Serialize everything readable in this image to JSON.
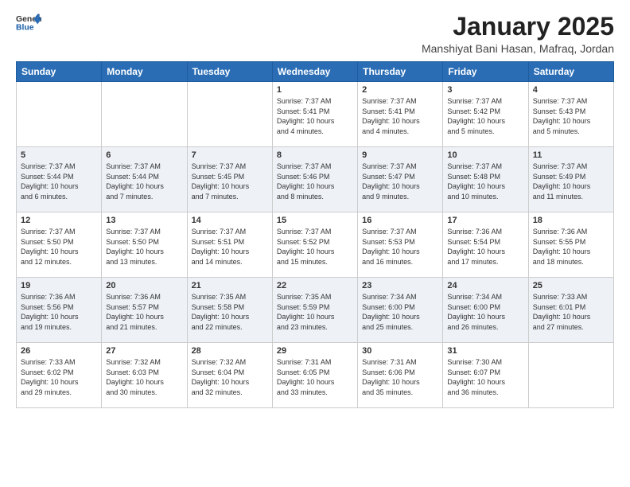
{
  "header": {
    "logo_general": "General",
    "logo_blue": "Blue",
    "month_title": "January 2025",
    "location": "Manshiyat Bani Hasan, Mafraq, Jordan"
  },
  "days_of_week": [
    "Sunday",
    "Monday",
    "Tuesday",
    "Wednesday",
    "Thursday",
    "Friday",
    "Saturday"
  ],
  "weeks": [
    [
      {
        "num": "",
        "info": ""
      },
      {
        "num": "",
        "info": ""
      },
      {
        "num": "",
        "info": ""
      },
      {
        "num": "1",
        "info": "Sunrise: 7:37 AM\nSunset: 5:41 PM\nDaylight: 10 hours\nand 4 minutes."
      },
      {
        "num": "2",
        "info": "Sunrise: 7:37 AM\nSunset: 5:41 PM\nDaylight: 10 hours\nand 4 minutes."
      },
      {
        "num": "3",
        "info": "Sunrise: 7:37 AM\nSunset: 5:42 PM\nDaylight: 10 hours\nand 5 minutes."
      },
      {
        "num": "4",
        "info": "Sunrise: 7:37 AM\nSunset: 5:43 PM\nDaylight: 10 hours\nand 5 minutes."
      }
    ],
    [
      {
        "num": "5",
        "info": "Sunrise: 7:37 AM\nSunset: 5:44 PM\nDaylight: 10 hours\nand 6 minutes."
      },
      {
        "num": "6",
        "info": "Sunrise: 7:37 AM\nSunset: 5:44 PM\nDaylight: 10 hours\nand 7 minutes."
      },
      {
        "num": "7",
        "info": "Sunrise: 7:37 AM\nSunset: 5:45 PM\nDaylight: 10 hours\nand 7 minutes."
      },
      {
        "num": "8",
        "info": "Sunrise: 7:37 AM\nSunset: 5:46 PM\nDaylight: 10 hours\nand 8 minutes."
      },
      {
        "num": "9",
        "info": "Sunrise: 7:37 AM\nSunset: 5:47 PM\nDaylight: 10 hours\nand 9 minutes."
      },
      {
        "num": "10",
        "info": "Sunrise: 7:37 AM\nSunset: 5:48 PM\nDaylight: 10 hours\nand 10 minutes."
      },
      {
        "num": "11",
        "info": "Sunrise: 7:37 AM\nSunset: 5:49 PM\nDaylight: 10 hours\nand 11 minutes."
      }
    ],
    [
      {
        "num": "12",
        "info": "Sunrise: 7:37 AM\nSunset: 5:50 PM\nDaylight: 10 hours\nand 12 minutes."
      },
      {
        "num": "13",
        "info": "Sunrise: 7:37 AM\nSunset: 5:50 PM\nDaylight: 10 hours\nand 13 minutes."
      },
      {
        "num": "14",
        "info": "Sunrise: 7:37 AM\nSunset: 5:51 PM\nDaylight: 10 hours\nand 14 minutes."
      },
      {
        "num": "15",
        "info": "Sunrise: 7:37 AM\nSunset: 5:52 PM\nDaylight: 10 hours\nand 15 minutes."
      },
      {
        "num": "16",
        "info": "Sunrise: 7:37 AM\nSunset: 5:53 PM\nDaylight: 10 hours\nand 16 minutes."
      },
      {
        "num": "17",
        "info": "Sunrise: 7:36 AM\nSunset: 5:54 PM\nDaylight: 10 hours\nand 17 minutes."
      },
      {
        "num": "18",
        "info": "Sunrise: 7:36 AM\nSunset: 5:55 PM\nDaylight: 10 hours\nand 18 minutes."
      }
    ],
    [
      {
        "num": "19",
        "info": "Sunrise: 7:36 AM\nSunset: 5:56 PM\nDaylight: 10 hours\nand 19 minutes."
      },
      {
        "num": "20",
        "info": "Sunrise: 7:36 AM\nSunset: 5:57 PM\nDaylight: 10 hours\nand 21 minutes."
      },
      {
        "num": "21",
        "info": "Sunrise: 7:35 AM\nSunset: 5:58 PM\nDaylight: 10 hours\nand 22 minutes."
      },
      {
        "num": "22",
        "info": "Sunrise: 7:35 AM\nSunset: 5:59 PM\nDaylight: 10 hours\nand 23 minutes."
      },
      {
        "num": "23",
        "info": "Sunrise: 7:34 AM\nSunset: 6:00 PM\nDaylight: 10 hours\nand 25 minutes."
      },
      {
        "num": "24",
        "info": "Sunrise: 7:34 AM\nSunset: 6:00 PM\nDaylight: 10 hours\nand 26 minutes."
      },
      {
        "num": "25",
        "info": "Sunrise: 7:33 AM\nSunset: 6:01 PM\nDaylight: 10 hours\nand 27 minutes."
      }
    ],
    [
      {
        "num": "26",
        "info": "Sunrise: 7:33 AM\nSunset: 6:02 PM\nDaylight: 10 hours\nand 29 minutes."
      },
      {
        "num": "27",
        "info": "Sunrise: 7:32 AM\nSunset: 6:03 PM\nDaylight: 10 hours\nand 30 minutes."
      },
      {
        "num": "28",
        "info": "Sunrise: 7:32 AM\nSunset: 6:04 PM\nDaylight: 10 hours\nand 32 minutes."
      },
      {
        "num": "29",
        "info": "Sunrise: 7:31 AM\nSunset: 6:05 PM\nDaylight: 10 hours\nand 33 minutes."
      },
      {
        "num": "30",
        "info": "Sunrise: 7:31 AM\nSunset: 6:06 PM\nDaylight: 10 hours\nand 35 minutes."
      },
      {
        "num": "31",
        "info": "Sunrise: 7:30 AM\nSunset: 6:07 PM\nDaylight: 10 hours\nand 36 minutes."
      },
      {
        "num": "",
        "info": ""
      }
    ]
  ]
}
